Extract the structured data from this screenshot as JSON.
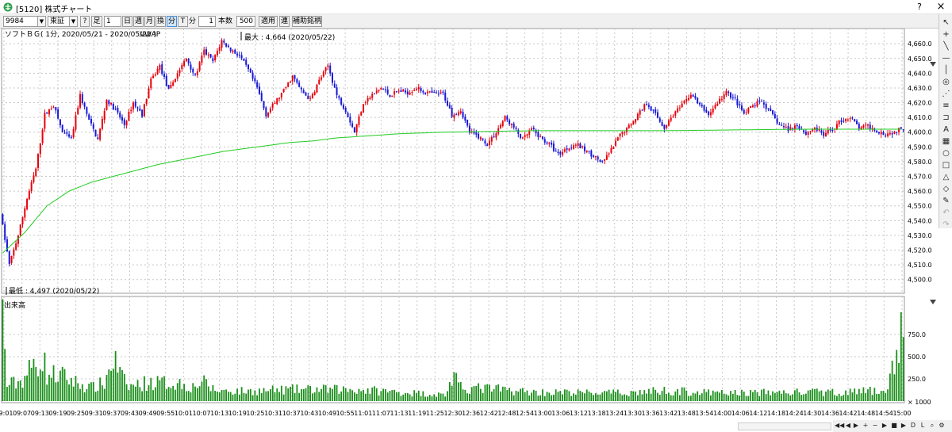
{
  "window": {
    "title": "[5120] 株式チャート",
    "help_label": "?",
    "close_label": "×"
  },
  "toolbar": {
    "code_value": "9984",
    "market_value": "東証",
    "help_label": "?",
    "ashi_label": "足",
    "period_value": "1",
    "day_label": "日",
    "week_label": "週",
    "month_label": "月",
    "other_label": "換",
    "minute_label": "分",
    "t_label": "T",
    "unit_label": "分",
    "unit_value": "1",
    "count_label": "本数",
    "count_value": "500",
    "apply_label": "適用",
    "link_label": "連",
    "register_label": "補助銘柄"
  },
  "chart": {
    "header": "ソフトＢＧ( 1分, 2020/05/21 - 2020/05/22 )",
    "vwap_label": "VWAP",
    "max_label": "最大 : 4,664 (2020/05/22)",
    "min_label": "最低 : 4,497 (2020/05/22)",
    "volume_label": "出来高",
    "volume_unit": "× 1000"
  },
  "chart_data": {
    "type": "candlestick",
    "ylim": [
      4495,
      4666
    ],
    "y_ticks": [
      "4,660.0",
      "4,650.0",
      "4,640.0",
      "4,630.0",
      "4,620.0",
      "4,610.0",
      "4,600.0",
      "4,590.0",
      "4,580.0",
      "4,570.0",
      "4,560.0",
      "4,550.0",
      "4,540.0",
      "4,530.0",
      "4,520.0",
      "4,510.0",
      "4,500.0"
    ],
    "volume_ticks": [
      "750.0",
      "500.0",
      "250.0"
    ],
    "volume_ylim": [
      0,
      1000
    ],
    "x_ticks": [
      "09:01",
      "09:07",
      "09:13",
      "09:19",
      "09:25",
      "09:31",
      "09:37",
      "09:43",
      "09:49",
      "09:55",
      "10:01",
      "10:07",
      "10:13",
      "10:19",
      "10:25",
      "10:31",
      "10:37",
      "10:43",
      "10:49",
      "10:55",
      "11:01",
      "11:07",
      "11:13",
      "11:19",
      "11:25",
      "12:30",
      "12:36",
      "12:42",
      "12:48",
      "12:54",
      "13:00",
      "13:06",
      "13:12",
      "13:18",
      "13:24",
      "13:30",
      "13:36",
      "13:42",
      "13:48",
      "13:54",
      "14:00",
      "14:06",
      "14:12",
      "14:18",
      "14:24",
      "14:30",
      "14:36",
      "14:42",
      "14:48",
      "14:54",
      "15:00"
    ],
    "price_path": [
      [
        0,
        4545
      ],
      [
        4,
        4510
      ],
      [
        8,
        4530
      ],
      [
        12,
        4555
      ],
      [
        16,
        4575
      ],
      [
        20,
        4612
      ],
      [
        24,
        4618
      ],
      [
        28,
        4600
      ],
      [
        32,
        4595
      ],
      [
        36,
        4625
      ],
      [
        40,
        4608
      ],
      [
        44,
        4595
      ],
      [
        48,
        4622
      ],
      [
        52,
        4615
      ],
      [
        56,
        4605
      ],
      [
        60,
        4620
      ],
      [
        64,
        4612
      ],
      [
        68,
        4635
      ],
      [
        72,
        4645
      ],
      [
        76,
        4628
      ],
      [
        80,
        4640
      ],
      [
        84,
        4650
      ],
      [
        88,
        4638
      ],
      [
        92,
        4655
      ],
      [
        96,
        4648
      ],
      [
        100,
        4662
      ],
      [
        104,
        4656
      ],
      [
        108,
        4652
      ],
      [
        112,
        4642
      ],
      [
        116,
        4630
      ],
      [
        120,
        4612
      ],
      [
        124,
        4620
      ],
      [
        128,
        4628
      ],
      [
        132,
        4638
      ],
      [
        136,
        4628
      ],
      [
        140,
        4622
      ],
      [
        144,
        4635
      ],
      [
        148,
        4645
      ],
      [
        152,
        4625
      ],
      [
        156,
        4615
      ],
      [
        160,
        4600
      ],
      [
        164,
        4620
      ],
      [
        168,
        4625
      ],
      [
        172,
        4630
      ],
      [
        176,
        4625
      ],
      [
        180,
        4628
      ],
      [
        184,
        4627
      ],
      [
        188,
        4630
      ],
      [
        192,
        4627
      ],
      [
        196,
        4626
      ],
      [
        200,
        4626
      ],
      [
        204,
        4612
      ],
      [
        208,
        4615
      ],
      [
        212,
        4600
      ],
      [
        216,
        4597
      ],
      [
        220,
        4592
      ],
      [
        224,
        4600
      ],
      [
        228,
        4610
      ],
      [
        232,
        4603
      ],
      [
        236,
        4595
      ],
      [
        240,
        4602
      ],
      [
        244,
        4596
      ],
      [
        248,
        4592
      ],
      [
        252,
        4585
      ],
      [
        256,
        4589
      ],
      [
        260,
        4592
      ],
      [
        264,
        4588
      ],
      [
        268,
        4584
      ],
      [
        272,
        4579
      ],
      [
        276,
        4588
      ],
      [
        280,
        4598
      ],
      [
        284,
        4604
      ],
      [
        288,
        4612
      ],
      [
        292,
        4620
      ],
      [
        296,
        4612
      ],
      [
        300,
        4603
      ],
      [
        304,
        4612
      ],
      [
        308,
        4618
      ],
      [
        312,
        4626
      ],
      [
        316,
        4618
      ],
      [
        320,
        4612
      ],
      [
        324,
        4620
      ],
      [
        328,
        4627
      ],
      [
        332,
        4622
      ],
      [
        336,
        4612
      ],
      [
        340,
        4618
      ],
      [
        344,
        4621
      ],
      [
        348,
        4613
      ],
      [
        352,
        4605
      ],
      [
        356,
        4602
      ],
      [
        360,
        4605
      ],
      [
        364,
        4599
      ],
      [
        368,
        4603
      ],
      [
        372,
        4598
      ],
      [
        376,
        4602
      ],
      [
        380,
        4608
      ],
      [
        384,
        4610
      ],
      [
        388,
        4603
      ],
      [
        392,
        4604
      ],
      [
        396,
        4601
      ],
      [
        400,
        4599
      ],
      [
        404,
        4600
      ],
      [
        408,
        4603
      ]
    ],
    "vwap_path": [
      [
        0,
        4518
      ],
      [
        10,
        4532
      ],
      [
        20,
        4550
      ],
      [
        30,
        4560
      ],
      [
        40,
        4566
      ],
      [
        50,
        4570
      ],
      [
        60,
        4574
      ],
      [
        70,
        4578
      ],
      [
        80,
        4581
      ],
      [
        90,
        4584
      ],
      [
        100,
        4587
      ],
      [
        110,
        4589
      ],
      [
        120,
        4591
      ],
      [
        130,
        4593
      ],
      [
        140,
        4594
      ],
      [
        150,
        4596
      ],
      [
        160,
        4597
      ],
      [
        170,
        4598
      ],
      [
        180,
        4599
      ],
      [
        200,
        4600
      ],
      [
        240,
        4601
      ],
      [
        300,
        4601
      ],
      [
        360,
        4602
      ],
      [
        400,
        4602
      ],
      [
        408,
        4602
      ]
    ],
    "volume_profile": [
      [
        0,
        950
      ],
      [
        2,
        180
      ],
      [
        8,
        220
      ],
      [
        14,
        400
      ],
      [
        18,
        500
      ],
      [
        20,
        300
      ],
      [
        26,
        290
      ],
      [
        36,
        180
      ],
      [
        40,
        150
      ],
      [
        46,
        200
      ],
      [
        50,
        480
      ],
      [
        56,
        160
      ],
      [
        66,
        210
      ],
      [
        80,
        200
      ],
      [
        86,
        160
      ],
      [
        90,
        220
      ],
      [
        96,
        120
      ],
      [
        110,
        110
      ],
      [
        130,
        130
      ],
      [
        160,
        130
      ],
      [
        200,
        70
      ],
      [
        204,
        300
      ],
      [
        206,
        150
      ],
      [
        220,
        140
      ],
      [
        240,
        100
      ],
      [
        280,
        90
      ],
      [
        300,
        120
      ],
      [
        320,
        90
      ],
      [
        360,
        100
      ],
      [
        380,
        100
      ],
      [
        400,
        120
      ],
      [
        406,
        780
      ],
      [
        408,
        780
      ]
    ]
  },
  "right_tools": [
    "cursor-icon",
    "crosshair-icon",
    "line-icon",
    "hline-icon",
    "vline-icon",
    "fibo-icon",
    "gann-icon",
    "channel-icon",
    "text-icon",
    "grid-icon",
    "ellipse-icon",
    "rect-icon",
    "triangle-icon",
    "eraser-icon",
    "pencil-icon",
    "undo-icon",
    "redo-icon"
  ],
  "bottom_nav": {
    "d_label": "D",
    "l_label": "L"
  },
  "colors": {
    "up": "#e8000b",
    "down": "#1818d8",
    "vwap": "#22cc22",
    "volume": "#1a8f1a",
    "grid": "#c8c8c8"
  }
}
